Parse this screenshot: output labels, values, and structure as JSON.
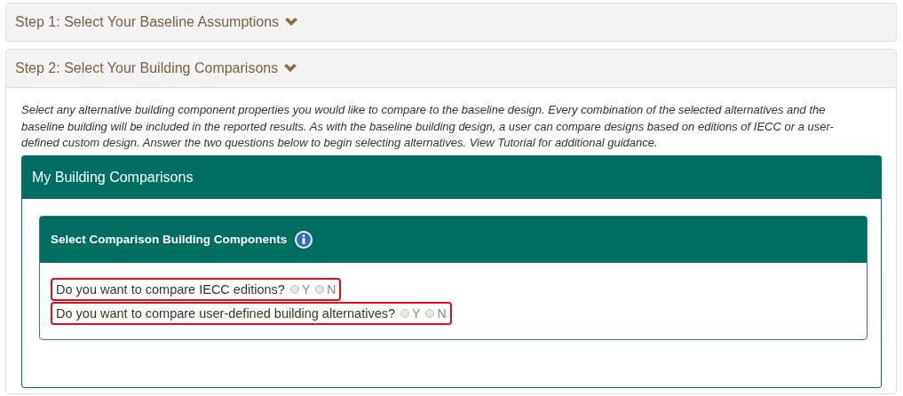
{
  "steps": [
    {
      "label": "Step 1: Select Your Baseline Assumptions",
      "expanded": false
    },
    {
      "label": "Step 2: Select Your Building Comparisons",
      "expanded": true
    }
  ],
  "intro": "Select any alternative building component properties you would like to compare to the baseline design. Every combination of the selected alternatives and the baseline building will be included in the reported results. As with the baseline building design, a user can compare designs based on editions of IECC or a user-defined custom design. Answer the two questions below to begin selecting alternatives. View Tutorial for additional guidance.",
  "panel": {
    "title": "My Building Comparisons",
    "subpanel": {
      "title": "Select Comparison Building Components",
      "questions": [
        {
          "text": "Do you want to compare IECC editions?",
          "highlighted": true,
          "options": [
            {
              "label": "Y",
              "selected": false
            },
            {
              "label": "N",
              "selected": false
            }
          ]
        },
        {
          "text": "Do you want to compare user-defined building alternatives?",
          "highlighted": true,
          "options": [
            {
              "label": "Y",
              "selected": false
            },
            {
              "label": "N",
              "selected": false
            }
          ]
        }
      ]
    }
  }
}
